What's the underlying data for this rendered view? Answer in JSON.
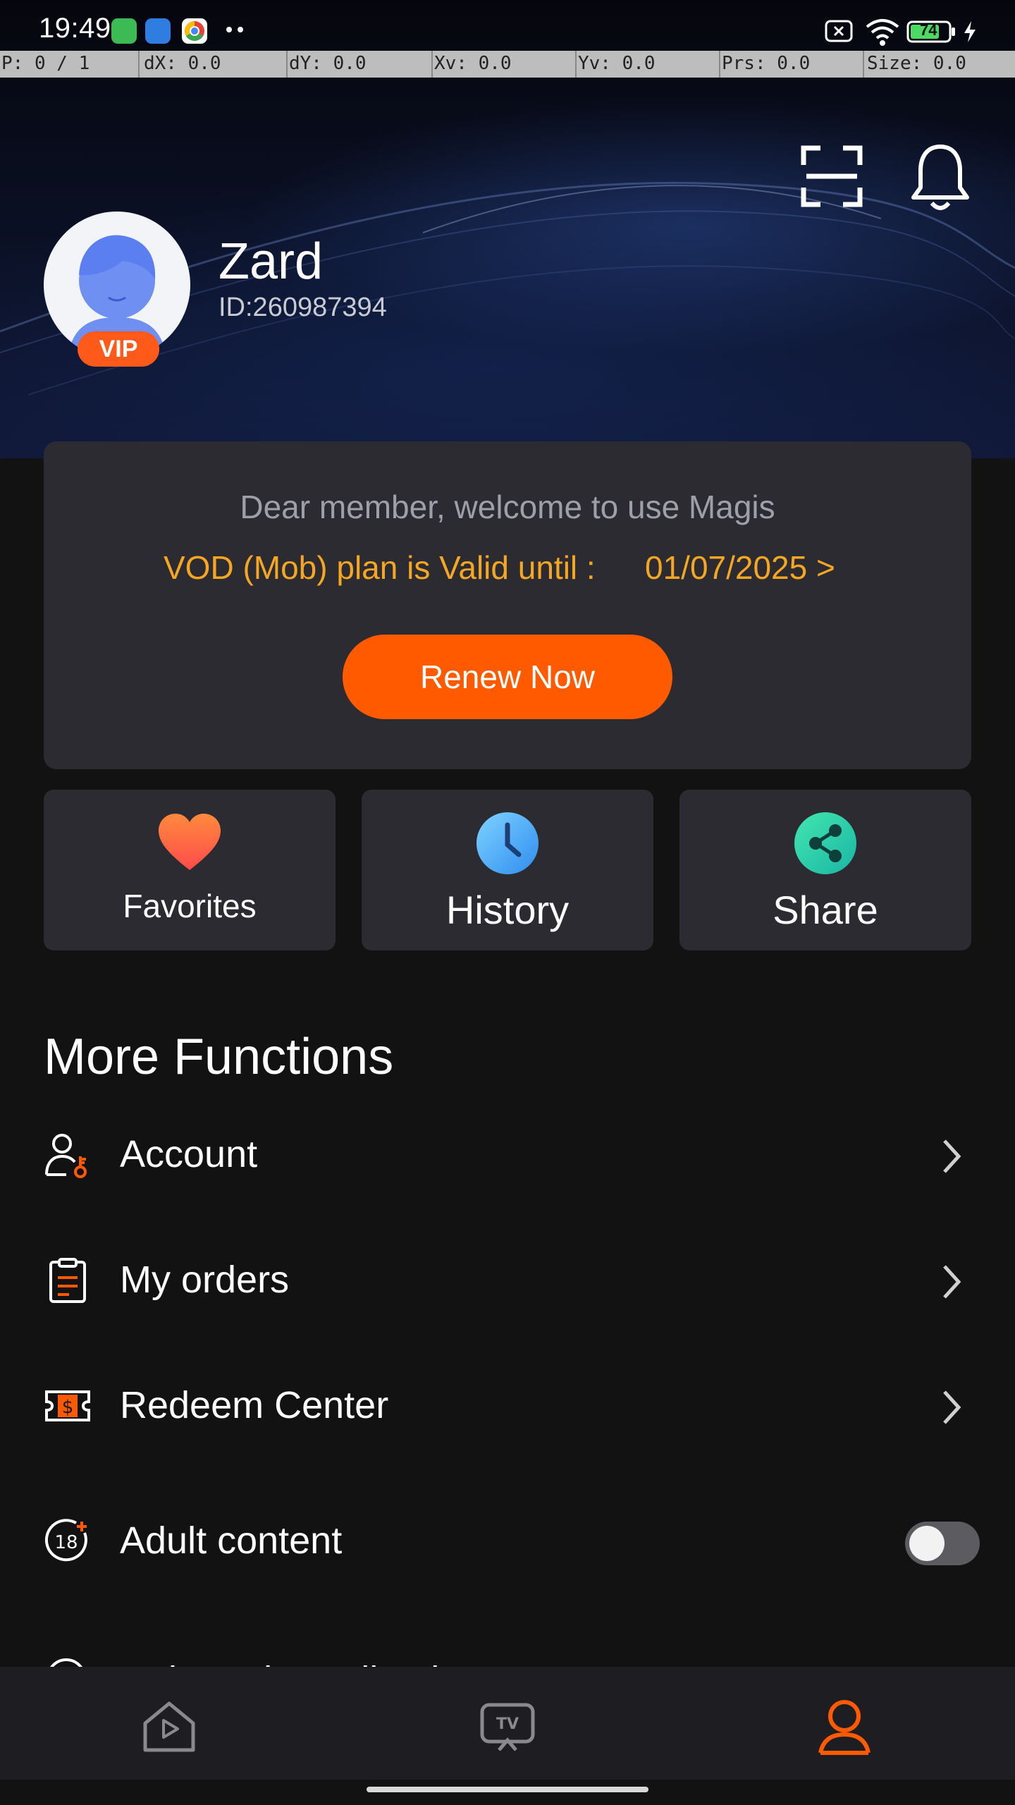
{
  "status_bar": {
    "time": "19:49",
    "battery_level": "74"
  },
  "debug_bar": {
    "pointer": "P: 0 / 1",
    "dx": "dX: 0.0",
    "dy": "dY: 0.0",
    "xv": "Xv: 0.0",
    "yv": "Yv: 0.0",
    "prs": "Prs: 0.0",
    "size": "Size: 0.0"
  },
  "profile": {
    "name": "Zard",
    "id": "ID:260987394",
    "badge": "VIP"
  },
  "membership": {
    "welcome": "Dear member, welcome to use Magis",
    "plan_text": "VOD (Mob) plan is Valid until :",
    "valid_until": "01/07/2025 >",
    "renew_label": "Renew Now"
  },
  "quick_actions": [
    {
      "label": "Favorites",
      "icon": "heart-icon"
    },
    {
      "label": "History",
      "icon": "clock-icon"
    },
    {
      "label": "Share",
      "icon": "share-icon"
    }
  ],
  "more_functions": {
    "title": "More Functions",
    "items": [
      {
        "label": "Account",
        "icon": "account-key-icon"
      },
      {
        "label": "My orders",
        "icon": "clipboard-icon"
      },
      {
        "label": "Redeem Center",
        "icon": "ticket-icon"
      },
      {
        "label": "Adult content",
        "icon": "eighteen-plus-icon",
        "toggle": false
      },
      {
        "label": "Help and Feedback",
        "icon": "help-icon"
      }
    ]
  },
  "bottom_nav": [
    {
      "label": "Home",
      "icon": "home-icon",
      "active": false
    },
    {
      "label": "TV",
      "icon": "tv-icon",
      "active": false
    },
    {
      "label": "Me",
      "icon": "profile-icon",
      "active": true
    }
  ],
  "colors": {
    "accent": "#ff5a00",
    "gold": "#f5a623",
    "card": "#2b2b31",
    "background": "#121212"
  }
}
